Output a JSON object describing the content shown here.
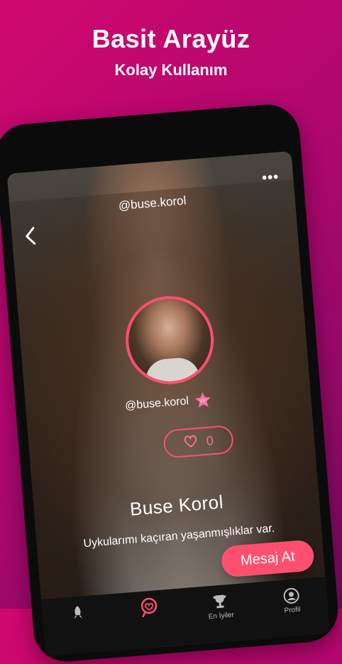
{
  "promo": {
    "title": "Basit Arayüz",
    "subtitle": "Kolay Kullanım"
  },
  "profile": {
    "top_username": "@buse.korol",
    "username": "@buse.korol",
    "badge": "VIP",
    "likes": "0",
    "name": "Buse Korol",
    "bio": "Uykularımı kaçıran yaşanmışlıklar var.",
    "message_button": "Mesaj At"
  },
  "tabs": [
    {
      "label": "",
      "icon": "rocket-icon"
    },
    {
      "label": "",
      "icon": "heart-search-icon"
    },
    {
      "label": "En İyiler",
      "icon": "trophy-icon"
    },
    {
      "label": "Profil",
      "icon": "user-icon"
    }
  ],
  "colors": {
    "accent": "#ff4f6e",
    "background_top": "#d0086d",
    "background_bottom": "#7c0a63"
  }
}
